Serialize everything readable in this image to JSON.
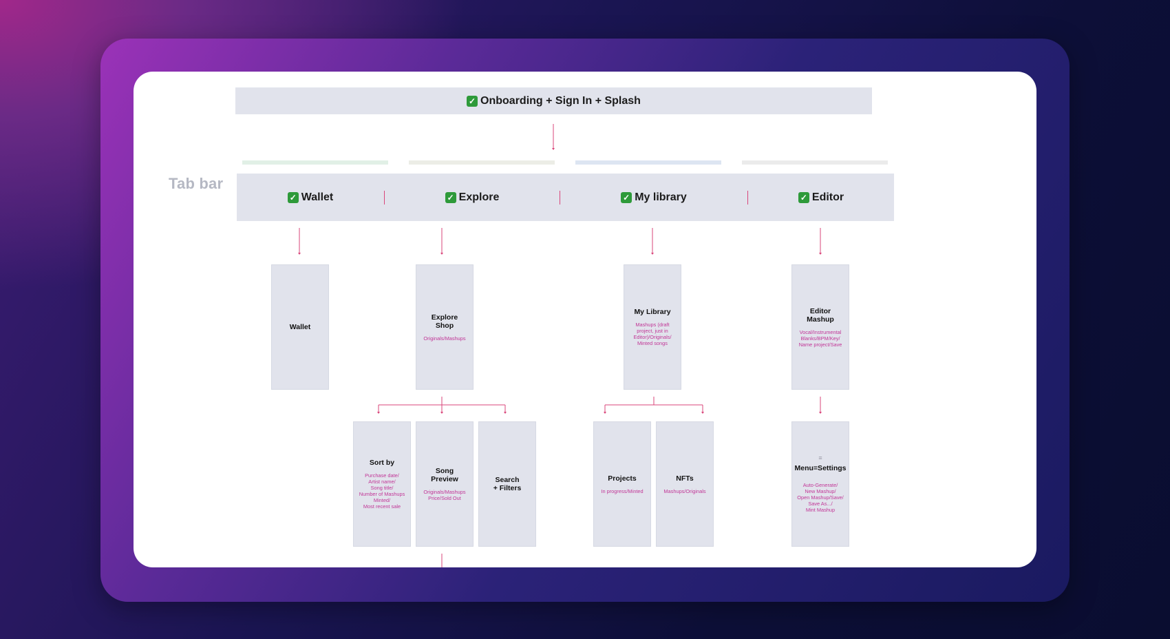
{
  "diagram": {
    "banner": {
      "title": "Onboarding + Sign In + Splash",
      "checked": true
    },
    "tabbar_label": "Tab bar",
    "strip_colors": [
      "#e1f0e6",
      "#ecede6",
      "#dde5f2",
      "#ebebeb"
    ],
    "accent_color": "#d9457a",
    "tabs": [
      {
        "label": "Wallet"
      },
      {
        "label": "Explore"
      },
      {
        "label": "My library"
      },
      {
        "label": "Editor"
      }
    ],
    "screens": {
      "wallet": {
        "title": "Wallet",
        "subtitle": ""
      },
      "explore_shop": {
        "title": "Explore\nShop",
        "subtitle": "Originals/Mashups"
      },
      "my_library": {
        "title": "My Library",
        "subtitle": "Mashups (draft\nproject, just in\nEditor)/Originals/\nMinted songs"
      },
      "editor_mashup": {
        "title": "Editor\nMashup",
        "subtitle": "Vocal/Instrumental\nBlanks/BPM/Key/\nName project/Save"
      },
      "sort_by": {
        "title": "Sort by",
        "subtitle": "Purchase date/\nArtist name/\nSong title/\nNumber of Mashups\nMinted/\nMost recent sale"
      },
      "song_preview": {
        "title": "Song\nPreview",
        "subtitle": "Originals/Mashups\nPrice/Sold Out"
      },
      "search_filters": {
        "title": "Search\n+ Filters",
        "subtitle": ""
      },
      "projects": {
        "title": "Projects",
        "subtitle": "In progress/Minted"
      },
      "nfts": {
        "title": "NFTs",
        "subtitle": "Mashups/Originals"
      },
      "menu_settings": {
        "title": "Menu=Settings",
        "subtitle": "Auto-Generate/\nNew Mashup/\nOpen Mashup/Save/\nSave As.../\nMint Mashup",
        "icon": "hamburger-menu-icon"
      }
    }
  }
}
